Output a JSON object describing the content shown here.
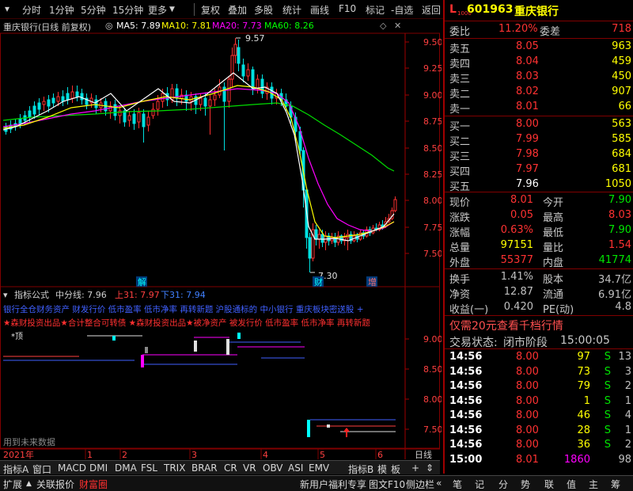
{
  "toolbar": {
    "items": [
      "分时",
      "1分钟",
      "5分钟",
      "15分钟",
      "更多",
      "复权",
      "叠加",
      "多股",
      "统计",
      "画线",
      "F10",
      "标记",
      "-自选",
      "返回"
    ]
  },
  "chart_header": {
    "stock_title": "重庆银行(日线 前复权)",
    "ma5": "MA5: 7.89",
    "ma10": "MA10: 7.81",
    "ma20": "MA20: 7.73",
    "ma60": "MA60: 8.26",
    "colors": {
      "ma5": "#ffffff",
      "ma10": "#ffff00",
      "ma20": "#ff00ff",
      "ma60": "#00ff00"
    }
  },
  "price_chart": {
    "y_ticks": [
      "9.50",
      "9.25",
      "9.00",
      "8.75",
      "8.50",
      "8.25",
      "8.00",
      "7.75",
      "7.50"
    ],
    "high_label": "9.57",
    "low_label": "7.30",
    "markers": [
      "解",
      "财",
      "增"
    ]
  },
  "indicator": {
    "title": "指标公式",
    "mid_label": "中分线: 7.96",
    "up_label": "上31: 7.97",
    "down_label": "下31: 7.94",
    "news_line1": "银行全仓财务资产 财发行价 低市盈率 低市净率 再转新题 沪股通标的 中小银行 重庆板块密送股 +",
    "news_line2": "★森财投资出品★合计整合可转债 ★森财投资出品★被净资产 被发行价 低市盈率 低市净率 再转新题",
    "top_label": "*顶",
    "footer_text": "用到未来数据",
    "y_ticks": [
      "9.00",
      "8.50",
      "8.00",
      "7.50"
    ]
  },
  "x_axis": {
    "year": "2021年",
    "months": [
      "1",
      "2",
      "3",
      "4",
      "5",
      "6"
    ],
    "period": "日线"
  },
  "tabs_row1": [
    "指标A",
    "窗口",
    "MACD",
    "DMI",
    "DMA",
    "FSL",
    "TRIX",
    "BRAR",
    "CR",
    "VR",
    "OBV",
    "ASI",
    "EMV",
    "指标B",
    "模",
    "板"
  ],
  "tabs_row2": {
    "left": [
      "扩展",
      "关联报价",
      "财富圈"
    ],
    "promo": "新用户福利专享",
    "right": [
      "图文F10",
      "侧边栏",
      "笔",
      "记",
      "分",
      "势",
      "联",
      "值",
      "主",
      "筹"
    ]
  },
  "quote": {
    "code": "601963",
    "name": "重庆银行",
    "wei_bi_label": "委比",
    "wei_bi": "11.20%",
    "wei_cha_label": "委差",
    "wei_cha": "718",
    "sells": [
      {
        "label": "卖五",
        "price": "8.05",
        "vol": "963"
      },
      {
        "label": "卖四",
        "price": "8.04",
        "vol": "459"
      },
      {
        "label": "卖三",
        "price": "8.03",
        "vol": "450"
      },
      {
        "label": "卖二",
        "price": "8.02",
        "vol": "907"
      },
      {
        "label": "卖一",
        "price": "8.01",
        "vol": "66"
      }
    ],
    "buys": [
      {
        "label": "买一",
        "price": "8.00",
        "vol": "563"
      },
      {
        "label": "买二",
        "price": "7.99",
        "vol": "585"
      },
      {
        "label": "买三",
        "price": "7.98",
        "vol": "684"
      },
      {
        "label": "买四",
        "price": "7.97",
        "vol": "681"
      },
      {
        "label": "买五",
        "price": "7.96",
        "vol": "1050"
      }
    ],
    "stats": [
      {
        "l1": "现价",
        "v1": "8.01",
        "l2": "今开",
        "v2": "7.90"
      },
      {
        "l1": "涨跌",
        "v1": "0.05",
        "l2": "最高",
        "v2": "8.03"
      },
      {
        "l1": "涨幅",
        "v1": "0.63%",
        "l2": "最低",
        "v2": "7.90"
      },
      {
        "l1": "总量",
        "v1": "97151",
        "l2": "量比",
        "v2": "1.54"
      },
      {
        "l1": "外盘",
        "v1": "55377",
        "l2": "内盘",
        "v2": "41774"
      }
    ],
    "stats2": [
      {
        "l1": "换手",
        "v1": "1.41%",
        "l2": "股本",
        "v2": "34.7亿"
      },
      {
        "l1": "净资",
        "v1": "12.87",
        "l2": "流通",
        "v2": "6.91亿"
      },
      {
        "l1": "收益(一)",
        "v1": "0.420",
        "l2": "PE(动)",
        "v2": "4.8"
      }
    ],
    "promo": "仅需20元查看千档行情",
    "trade_status_label": "交易状态:",
    "trade_status": "闭市阶段",
    "trade_time": "15:00:05",
    "ticks": [
      {
        "t": "14:56",
        "p": "8.00",
        "v": "97",
        "f": "S",
        "n": "13"
      },
      {
        "t": "14:56",
        "p": "8.00",
        "v": "73",
        "f": "S",
        "n": "3"
      },
      {
        "t": "14:56",
        "p": "8.00",
        "v": "79",
        "f": "S",
        "n": "2"
      },
      {
        "t": "14:56",
        "p": "8.00",
        "v": "1",
        "f": "S",
        "n": "1"
      },
      {
        "t": "14:56",
        "p": "8.00",
        "v": "46",
        "f": "S",
        "n": "4"
      },
      {
        "t": "14:56",
        "p": "8.00",
        "v": "28",
        "f": "S",
        "n": "1"
      },
      {
        "t": "14:56",
        "p": "8.00",
        "v": "36",
        "f": "S",
        "n": "2"
      },
      {
        "t": "15:00",
        "p": "8.01",
        "v": "1860",
        "f": "",
        "n": "98"
      }
    ]
  }
}
